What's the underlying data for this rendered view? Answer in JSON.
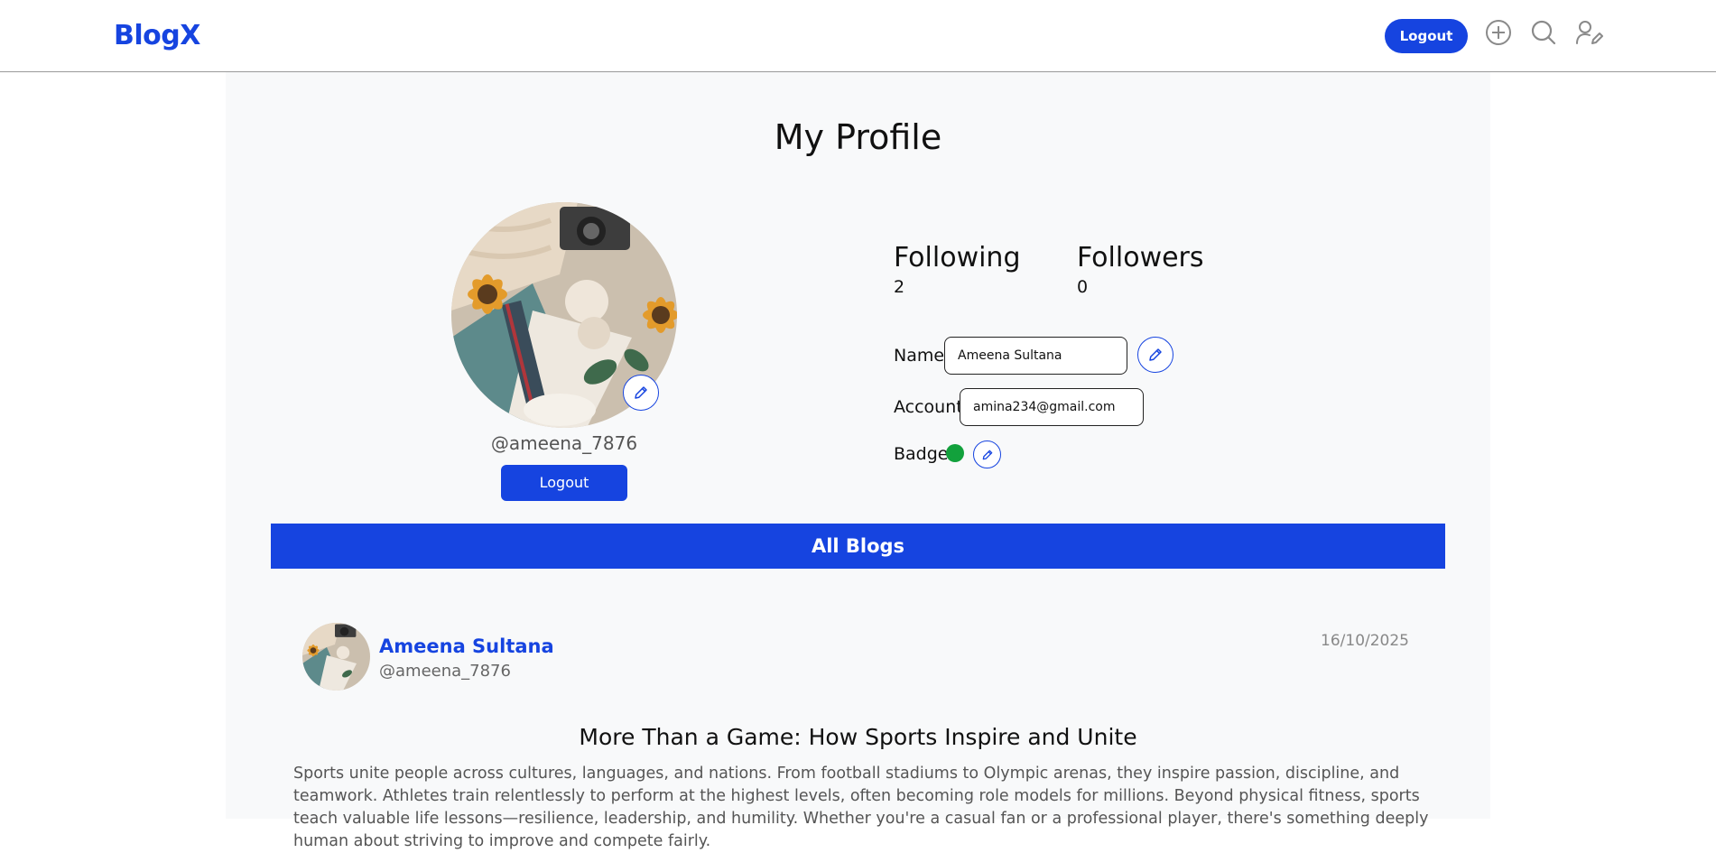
{
  "navbar": {
    "brand": "BlogX",
    "logout_label": "Logout",
    "icons": [
      "add-circle-icon",
      "search-icon",
      "edit-profile-icon"
    ]
  },
  "profile": {
    "title": "My Profile",
    "handle": "@ameena_7876",
    "logout_label": "Logout",
    "following_label": "Following",
    "following_count": "2",
    "followers_label": "Followers",
    "followers_count": "0",
    "name_label": "Name",
    "name_value": "Ameena Sultana",
    "account_label": "Account",
    "account_value": "amina234@gmail.com",
    "badge_label": "Badge",
    "badge_color": "#12a13c"
  },
  "blogs": {
    "section_label": "All Blogs",
    "items": [
      {
        "author": "Ameena Sultana",
        "handle": "@ameena_7876",
        "date": "16/10/2025",
        "title": "More Than a Game: How Sports Inspire and Unite",
        "body": "Sports unite people across cultures, languages, and nations. From football stadiums to Olympic arenas, they inspire passion, discipline, and teamwork. Athletes train relentlessly to perform at the highest levels, often becoming role models for millions. Beyond physical fitness, sports teach valuable life lessons—resilience, leadership, and humility. Whether you're a casual fan or a professional player, there's something deeply human about striving to improve and compete fairly."
      }
    ]
  },
  "colors": {
    "accent": "#1644e0",
    "panel_bg": "#f8f9fa"
  }
}
